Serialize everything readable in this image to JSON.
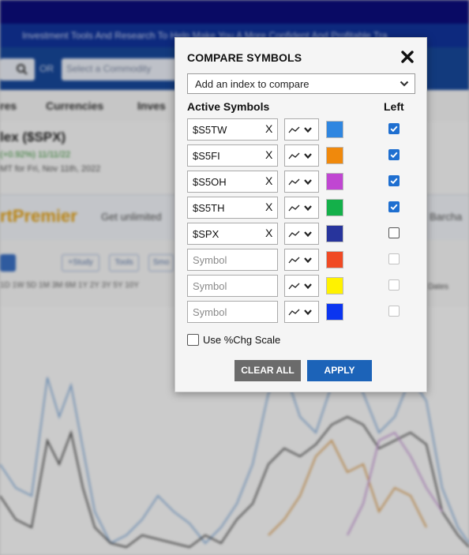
{
  "background": {
    "tagline": "Investment Tools And Research To Help Make You A More Confident And Profitable Tra",
    "search_or": "OR",
    "commodity_placeholder": "Select a Commodity",
    "nav": [
      "res",
      "Currencies",
      "Inves"
    ],
    "quote_title": "lex ($SPX)",
    "quote_change": "(+0.92%) 11/11/22",
    "quote_date": "MT for Fri, Nov 11th, 2022",
    "promo_brand": "rtPremier",
    "promo_text": "Get unlimited",
    "promo_right": "Barcha",
    "tool_labels": [
      "+Study",
      "Tools",
      "Smo"
    ],
    "periods": "1D  1W  5D  1M  3M  6M  1Y  2Y  3Y  5Y  10Y",
    "dates_label": "Dates"
  },
  "modal": {
    "title": "COMPARE SYMBOLS",
    "close_icon": "close-x-icon",
    "index_select_label": "Add an index to compare",
    "active_header": "Active Symbols",
    "left_header": "Left",
    "rows": [
      {
        "symbol": "$S5TW",
        "clear": "X",
        "color": "#2f86e0",
        "left": "checked"
      },
      {
        "symbol": "$S5FI",
        "clear": "X",
        "color": "#f0890c",
        "left": "checked"
      },
      {
        "symbol": "$S5OH",
        "clear": "X",
        "color": "#c046d2",
        "left": "checked"
      },
      {
        "symbol": "$S5TH",
        "clear": "X",
        "color": "#14b04a",
        "left": "checked"
      },
      {
        "symbol": "$SPX",
        "clear": "X",
        "color": "#27349c",
        "left": "unchecked"
      },
      {
        "symbol": "",
        "placeholder": "Symbol",
        "color": "#f04a24",
        "left": "disabled"
      },
      {
        "symbol": "",
        "placeholder": "Symbol",
        "color": "#fff200",
        "left": "disabled"
      },
      {
        "symbol": "",
        "placeholder": "Symbol",
        "color": "#0b35f0",
        "left": "disabled"
      }
    ],
    "pct_scale_label": "Use %Chg Scale",
    "clear_all_label": "CLEAR ALL",
    "apply_label": "APPLY"
  }
}
